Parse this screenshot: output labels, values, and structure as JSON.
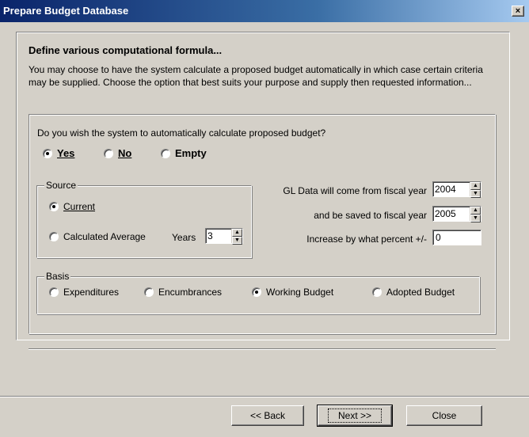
{
  "window": {
    "title": "Prepare Budget Database",
    "close_label": "×"
  },
  "heading": "Define various computational formula...",
  "description": "You may choose to have the system calculate a proposed budget automatically in which case certain criteria may be supplied.  Choose the option that best suits your purpose and supply then requested information...",
  "question": "Do you wish the system to automatically calculate proposed budget?",
  "calc_options": {
    "yes": "Yes",
    "no": "No",
    "empty": "Empty",
    "selected": "Yes"
  },
  "source": {
    "title": "Source",
    "current": "Current",
    "calc_avg": "Calculated Average",
    "years_label": "Years",
    "years_value": "3",
    "selected": "Current"
  },
  "gl": {
    "from_label": "GL Data will come from fiscal year",
    "from_value": "2004",
    "to_label": "and be saved to fiscal year",
    "to_value": "2005",
    "percent_label": "Increase by what percent +/-",
    "percent_value": "0"
  },
  "basis": {
    "title": "Basis",
    "expenditures": "Expenditures",
    "encumbrances": "Encumbrances",
    "working": "Working Budget",
    "adopted": "Adopted Budget",
    "selected": "Working Budget"
  },
  "buttons": {
    "back": "<< Back",
    "next": "Next >>",
    "close": "Close"
  },
  "icons": {
    "spin_up": "▲",
    "spin_down": "▼"
  }
}
